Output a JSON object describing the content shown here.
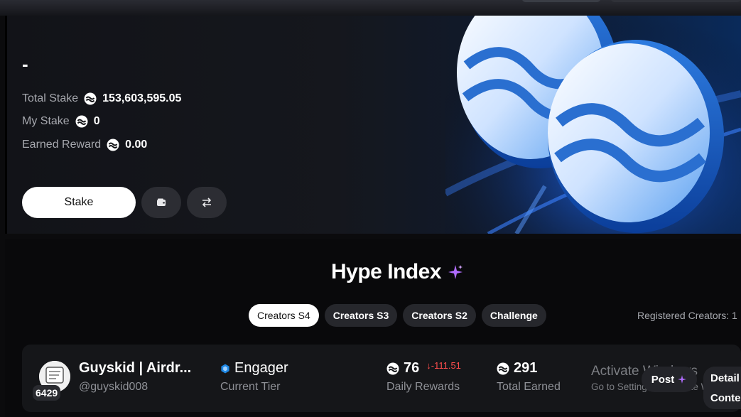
{
  "hero": {
    "name_placeholder": "-",
    "stats": [
      {
        "label": "Total Stake",
        "value": "153,603,595.05"
      },
      {
        "label": "My Stake",
        "value": "0"
      },
      {
        "label": "Earned Reward",
        "value": "0.00"
      }
    ],
    "stake_label": "Stake",
    "icons": [
      "wallet-icon",
      "swap-icon",
      "sui-token-icon"
    ]
  },
  "hype": {
    "title": "Hype Index",
    "tabs": [
      "Creators S4",
      "Creators S3",
      "Creators S2",
      "Challenge"
    ],
    "active_tab": "Creators S4",
    "registered_label": "Registered Creators: 1"
  },
  "creator": {
    "rank": "6429",
    "name": "Guyskid | Airdr...",
    "handle": "@guyskid008",
    "tier": "Engager",
    "tier_label": "Current Tier",
    "daily_rewards": "76",
    "daily_delta": "↓-111.51",
    "daily_label": "Daily Rewards",
    "total_earned": "291",
    "total_label": "Total Earned",
    "post_label": "Post",
    "detail_label_1": "Detail",
    "detail_label_2": "Conte"
  },
  "windows_watermark": {
    "title": "Activate Windows",
    "subtitle": "Go to Settings to activate Windows."
  },
  "colors": {
    "accent_blue": "#1e88e5",
    "negative_red": "#ff4d4d",
    "sparkle_purple": "#b06cff"
  }
}
